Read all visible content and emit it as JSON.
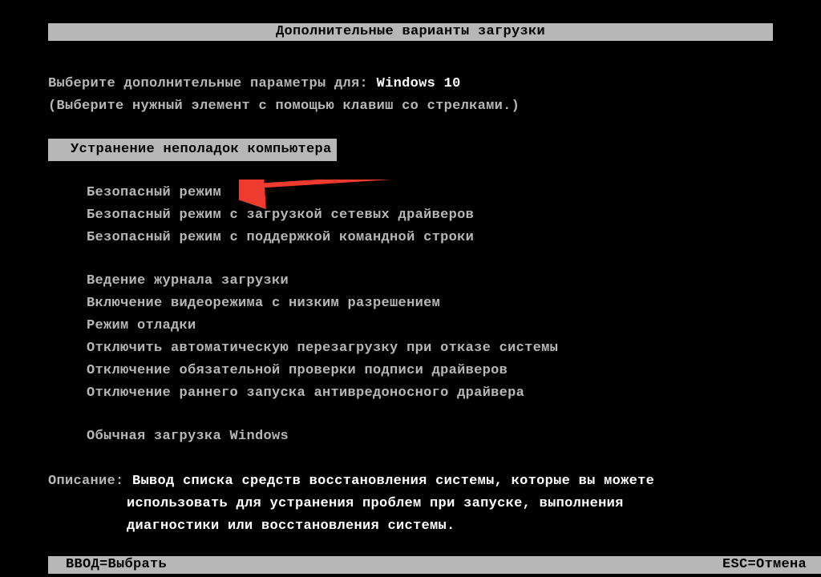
{
  "title": "Дополнительные варианты загрузки",
  "prompt": {
    "text": "Выберите дополнительные параметры для:",
    "os": "Windows 10"
  },
  "hint": "(Выберите нужный элемент с помощью клавиш со стрелками.)",
  "selected_option": "Устранение неполадок компьютера",
  "options_group1": [
    "Безопасный режим",
    "Безопасный режим с загрузкой сетевых драйверов",
    "Безопасный режим с поддержкой командной строки"
  ],
  "options_group2": [
    "Ведение журнала загрузки",
    "Включение видеорежима с низким разрешением",
    "Режим отладки",
    "Отключить автоматическую перезагрузку при отказе системы",
    "Отключение обязательной проверки подписи драйверов",
    "Отключение раннего запуска антивредоносного драйвера"
  ],
  "options_group3": [
    "Обычная загрузка Windows"
  ],
  "description": {
    "label": "Описание:",
    "lines": [
      "Вывод списка средств восстановления системы, которые вы можете",
      "использовать для устранения проблем при запуске, выполнения",
      "диагностики или восстановления системы."
    ]
  },
  "footer": {
    "enter": "ВВОД=Выбрать",
    "esc": "ESC=Отмена"
  },
  "colors": {
    "bg": "#000000",
    "text": "#b7b7b7",
    "highlight_bg": "#b7b7b7",
    "highlight_fg": "#000000",
    "bright": "#ffffff",
    "arrow": "#ed3b2f"
  }
}
